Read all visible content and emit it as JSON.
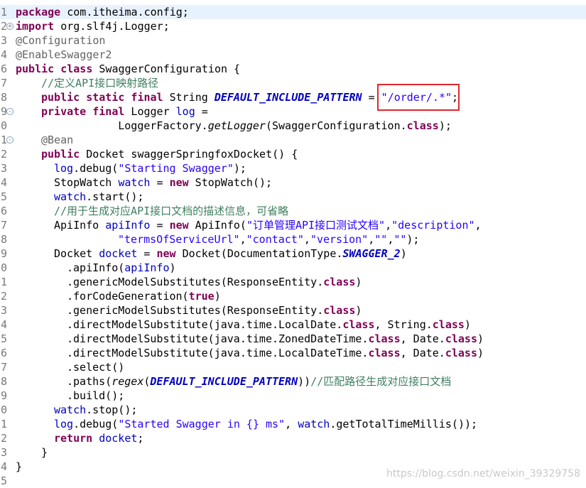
{
  "editor": {
    "lines": [
      {
        "no": "1",
        "fold": "",
        "current": true,
        "tokens": [
          [
            "kw",
            "package"
          ],
          [
            "",
            "com.itheima.config;"
          ]
        ]
      },
      {
        "no": "2",
        "fold": "+",
        "current": false,
        "tokens": [
          [
            "kw",
            "import"
          ],
          [
            "",
            "org.slf4j.Logger;"
          ]
        ]
      },
      {
        "no": "3",
        "fold": "",
        "current": false,
        "tokens": [
          [
            "ann",
            "@Configuration"
          ]
        ]
      },
      {
        "no": "4",
        "fold": "",
        "current": false,
        "tokens": [
          [
            "ann",
            "@EnableSwagger2"
          ]
        ]
      },
      {
        "no": "6",
        "fold": "",
        "current": false,
        "tokens": [
          [
            "kw",
            "public class"
          ],
          [
            "",
            "SwaggerConfiguration {"
          ]
        ]
      },
      {
        "no": "7",
        "fold": "",
        "current": false,
        "tokens": [
          [
            "",
            ""
          ],
          [
            "cmt",
            "//定义API接口映射路径"
          ]
        ]
      },
      {
        "no": "8",
        "fold": "",
        "current": false,
        "tokens": [
          [
            "",
            ""
          ],
          [
            "kw",
            "public static final"
          ],
          [
            "",
            " String "
          ],
          [
            "cst",
            "DEFAULT_INCLUDE_PATTERN"
          ],
          [
            "",
            " = "
          ],
          [
            "str",
            "\"/order/.*\""
          ],
          [
            "",
            ";"
          ]
        ]
      },
      {
        "no": "9",
        "fold": "-",
        "current": false,
        "tokens": [
          [
            "",
            ""
          ],
          [
            "kw",
            "private final"
          ],
          [
            "",
            " Logger "
          ],
          [
            "fld",
            "log"
          ],
          [
            "",
            " ="
          ]
        ]
      },
      {
        "no": "0",
        "fold": "",
        "current": false,
        "tokens": [
          [
            "",
            "        LoggerFactory."
          ],
          [
            "it",
            "getLogger"
          ],
          [
            "",
            "(SwaggerConfiguration."
          ],
          [
            "kw",
            "class"
          ],
          [
            "",
            ");"
          ]
        ]
      },
      {
        "no": "1",
        "fold": "-",
        "current": false,
        "tokens": [
          [
            "",
            ""
          ],
          [
            "ann",
            "@Bean"
          ]
        ]
      },
      {
        "no": "2",
        "fold": "",
        "current": false,
        "tokens": [
          [
            "",
            ""
          ],
          [
            "kw",
            "public"
          ],
          [
            "",
            " Docket swaggerSpringfoxDocket() {"
          ]
        ]
      },
      {
        "no": "3",
        "fold": "",
        "current": false,
        "tokens": [
          [
            "",
            ""
          ],
          [
            "fld",
            "log"
          ],
          [
            "",
            ".debug("
          ],
          [
            "str",
            "\"Starting Swagger\""
          ],
          [
            "",
            ");"
          ]
        ]
      },
      {
        "no": "4",
        "fold": "",
        "current": false,
        "tokens": [
          [
            "",
            "StopWatch "
          ],
          [
            "fld",
            "watch"
          ],
          [
            "",
            " = "
          ],
          [
            "kw",
            "new"
          ],
          [
            "",
            " StopWatch();"
          ]
        ]
      },
      {
        "no": "5",
        "fold": "",
        "current": false,
        "tokens": [
          [
            "",
            ""
          ],
          [
            "fld",
            "watch"
          ],
          [
            "",
            ".start();"
          ]
        ]
      },
      {
        "no": "6",
        "fold": "",
        "current": false,
        "tokens": [
          [
            "",
            ""
          ],
          [
            "cmt",
            "//用于生成对应API接口文档的描述信息，可省略"
          ]
        ]
      },
      {
        "no": "7",
        "fold": "",
        "current": false,
        "tokens": [
          [
            "",
            "ApiInfo "
          ],
          [
            "fld",
            "apiInfo"
          ],
          [
            "",
            " = "
          ],
          [
            "kw",
            "new"
          ],
          [
            "",
            " ApiInfo("
          ],
          [
            "str",
            "\"订单管理API接口测试文档\""
          ],
          [
            "",
            ","
          ],
          [
            "str",
            "\"description\""
          ],
          [
            "",
            ","
          ]
        ]
      },
      {
        "no": "8",
        "fold": "",
        "current": false,
        "tokens": [
          [
            "",
            ""
          ],
          [
            "str",
            "\"termsOfServiceUrl\""
          ],
          [
            "",
            ","
          ],
          [
            "str",
            "\"contact\""
          ],
          [
            "",
            ","
          ],
          [
            "str",
            "\"version\""
          ],
          [
            "",
            ","
          ],
          [
            "str",
            "\"\""
          ],
          [
            "",
            ","
          ],
          [
            "str",
            "\"\""
          ],
          [
            "",
            ");"
          ]
        ]
      },
      {
        "no": "9",
        "fold": "",
        "current": false,
        "tokens": [
          [
            "",
            "Docket "
          ],
          [
            "fld",
            "docket"
          ],
          [
            "",
            " = "
          ],
          [
            "kw",
            "new"
          ],
          [
            "",
            " Docket(DocumentationType."
          ],
          [
            "cst",
            "SWAGGER_2"
          ],
          [
            "",
            ")"
          ]
        ]
      },
      {
        "no": "0",
        "fold": "",
        "current": false,
        "tokens": [
          [
            "",
            ".apiInfo("
          ],
          [
            "fld",
            "apiInfo"
          ],
          [
            "",
            ")"
          ]
        ]
      },
      {
        "no": "1",
        "fold": "",
        "current": false,
        "tokens": [
          [
            "",
            ".genericModelSubstitutes(ResponseEntity."
          ],
          [
            "kw",
            "class"
          ],
          [
            "",
            ")"
          ]
        ]
      },
      {
        "no": "2",
        "fold": "",
        "current": false,
        "tokens": [
          [
            "",
            ".forCodeGeneration("
          ],
          [
            "kw",
            "true"
          ],
          [
            "",
            ")"
          ]
        ]
      },
      {
        "no": "3",
        "fold": "",
        "current": false,
        "tokens": [
          [
            "",
            ".genericModelSubstitutes(ResponseEntity."
          ],
          [
            "kw",
            "class"
          ],
          [
            "",
            ")"
          ]
        ]
      },
      {
        "no": "4",
        "fold": "",
        "current": false,
        "tokens": [
          [
            "",
            ".directModelSubstitute(java.time.LocalDate."
          ],
          [
            "kw",
            "class"
          ],
          [
            "",
            ", String."
          ],
          [
            "kw",
            "class"
          ],
          [
            "",
            ")"
          ]
        ]
      },
      {
        "no": "5",
        "fold": "",
        "current": false,
        "tokens": [
          [
            "",
            ".directModelSubstitute(java.time.ZonedDateTime."
          ],
          [
            "kw",
            "class"
          ],
          [
            "",
            ", Date."
          ],
          [
            "kw",
            "class"
          ],
          [
            "",
            ")"
          ]
        ]
      },
      {
        "no": "6",
        "fold": "",
        "current": false,
        "tokens": [
          [
            "",
            ".directModelSubstitute(java.time.LocalDateTime."
          ],
          [
            "kw",
            "class"
          ],
          [
            "",
            ", Date."
          ],
          [
            "kw",
            "class"
          ],
          [
            "",
            ")"
          ]
        ]
      },
      {
        "no": "7",
        "fold": "",
        "current": false,
        "tokens": [
          [
            "",
            ".select()"
          ]
        ]
      },
      {
        "no": "8",
        "fold": "",
        "current": false,
        "tokens": [
          [
            "",
            ".paths("
          ],
          [
            "it",
            "regex"
          ],
          [
            "",
            "("
          ],
          [
            "cst",
            "DEFAULT_INCLUDE_PATTERN"
          ],
          [
            "",
            "))"
          ],
          [
            "cmt",
            "//匹配路径生成对应接口文档"
          ]
        ]
      },
      {
        "no": "9",
        "fold": "",
        "current": false,
        "tokens": [
          [
            "",
            ".build();"
          ]
        ]
      },
      {
        "no": "0",
        "fold": "",
        "current": false,
        "tokens": [
          [
            "",
            ""
          ],
          [
            "fld",
            "watch"
          ],
          [
            "",
            ".stop();"
          ]
        ]
      },
      {
        "no": "1",
        "fold": "",
        "current": false,
        "tokens": [
          [
            "",
            ""
          ],
          [
            "fld",
            "log"
          ],
          [
            "",
            ".debug("
          ],
          [
            "str",
            "\"Started Swagger in {} ms\""
          ],
          [
            "",
            ", "
          ],
          [
            "fld",
            "watch"
          ],
          [
            "",
            ".getTotalTimeMillis());"
          ]
        ]
      },
      {
        "no": "2",
        "fold": "",
        "current": false,
        "tokens": [
          [
            "",
            ""
          ],
          [
            "kw",
            "return"
          ],
          [
            "",
            " "
          ],
          [
            "fld",
            "docket"
          ],
          [
            "",
            ";"
          ]
        ]
      },
      {
        "no": "3",
        "fold": "",
        "current": false,
        "tokens": [
          [
            "",
            "}"
          ]
        ]
      },
      {
        "no": "4",
        "fold": "",
        "current": false,
        "tokens": [
          [
            "",
            "}"
          ]
        ]
      },
      {
        "no": "5",
        "fold": "",
        "current": false,
        "tokens": [
          [
            "",
            ""
          ]
        ]
      }
    ]
  },
  "watermark": "https://blog.csdn.net/weixin_39329758",
  "colors": {
    "keyword": "#7f0055",
    "string": "#2a00ff",
    "comment": "#3f7f5f",
    "annotation": "#646464",
    "field": "#0000c0",
    "highlight_border": "#e0282e",
    "current_line": "#e8f2fe"
  }
}
